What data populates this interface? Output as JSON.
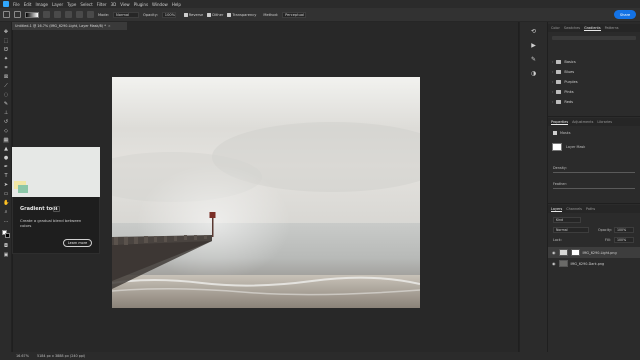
{
  "menu": {
    "items": [
      "File",
      "Edit",
      "Image",
      "Layer",
      "Type",
      "Select",
      "Filter",
      "3D",
      "View",
      "Plugins",
      "Window",
      "Help"
    ]
  },
  "options_bar": {
    "mode_label": "Mode:",
    "mode_value": "Normal",
    "opacity_label": "Opacity:",
    "opacity_value": "100%",
    "reverse_label": "Reverse",
    "dither_label": "Dither",
    "transparency_label": "Transparency",
    "method_label": "Method:",
    "method_value": "Perceptual",
    "share_label": "Share"
  },
  "document": {
    "tab_title": "Untitled-1 @ 16.7% (IMG_6290-Light, Layer Mask/8) *",
    "close_symbol": "×"
  },
  "tooltip": {
    "title": "Gradient tool",
    "shortcut": "G",
    "description": "Create a gradual blend between colors",
    "learn_more": "Learn more"
  },
  "status_bar": {
    "zoom": "16.67%",
    "doc_info": "5184 px x 3888 px (240 ppi)"
  },
  "panels": {
    "top_tabs": [
      "Color",
      "Swatches",
      "Gradients",
      "Patterns"
    ],
    "top_active": "Gradients",
    "gradient_folders": [
      "Basics",
      "Blues",
      "Purples",
      "Pinks",
      "Reds"
    ],
    "props_tabs": [
      "Properties",
      "Adjustments",
      "Libraries"
    ],
    "props_kind": "Masks",
    "props_layer_mask": "Layer Mask",
    "density_label": "Density:",
    "feather_label": "Feather:",
    "layers_tabs": [
      "Layers",
      "Channels",
      "Paths"
    ],
    "layers_filter": "Kind",
    "blend_mode": "Normal",
    "opacity_label": "Opacity:",
    "opacity_value": "100%",
    "lock_label": "Lock:",
    "fill_label": "Fill:",
    "fill_value": "100%",
    "layers": [
      {
        "name": "IMG_6290-Light.png"
      },
      {
        "name": "IMG_6290-Dark.png"
      }
    ]
  },
  "colors": {
    "accent": "#1473e6",
    "ps_blue": "#31a8ff",
    "bg_dark": "#1f1f1f",
    "panel": "#2b2b2b"
  }
}
